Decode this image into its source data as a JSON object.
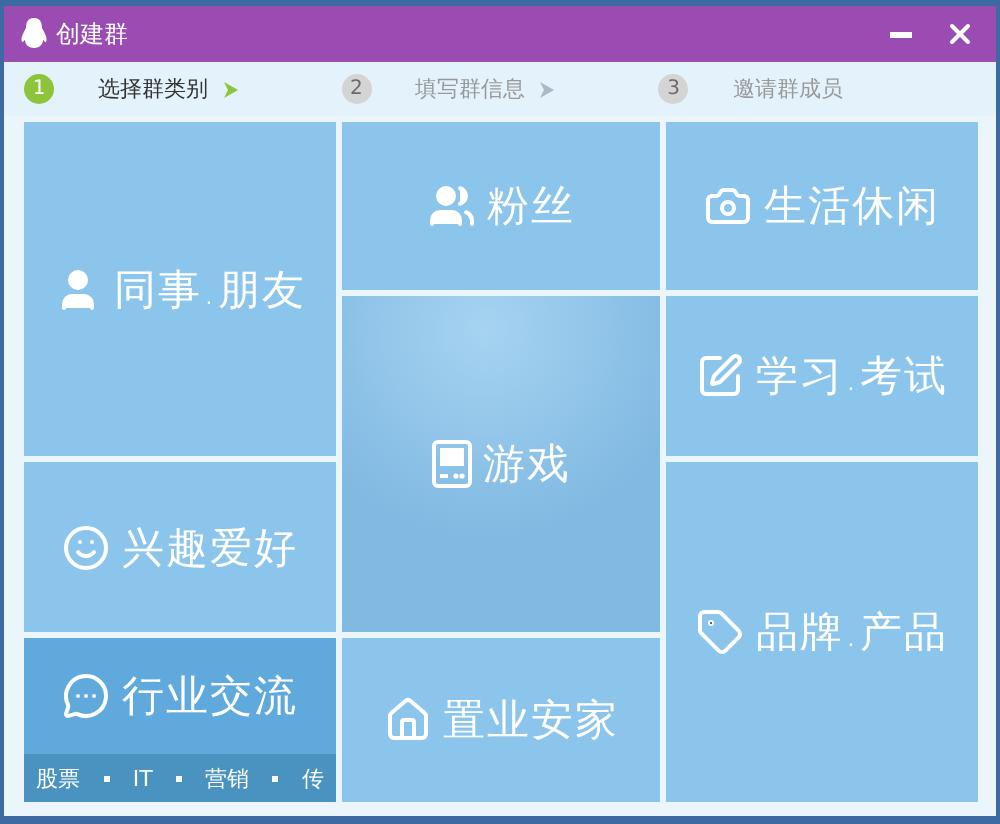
{
  "window": {
    "title": "创建群"
  },
  "steps": [
    {
      "number": "1",
      "label": "选择群类别",
      "selected": true
    },
    {
      "number": "2",
      "label": "填写群信息",
      "selected": false
    },
    {
      "number": "3",
      "label": "邀请群成员",
      "selected": false
    }
  ],
  "tiles": [
    {
      "label": "同事.朋友",
      "highlighted": false
    },
    {
      "label": "粉丝",
      "highlighted": false
    },
    {
      "label": "生活休闲",
      "highlighted": false
    },
    {
      "label": "游戏",
      "highlighted": true
    },
    {
      "label": "学习.考试",
      "highlighted": false
    },
    {
      "label": "兴趣爱好",
      "highlighted": false
    },
    {
      "label": "品牌.产品",
      "highlighted": false
    },
    {
      "label": "行业交流",
      "highlighted": true,
      "tags": [
        "股票",
        "IT",
        "营销",
        "传"
      ]
    },
    {
      "label": "置业安家",
      "highlighted": false
    }
  ]
}
